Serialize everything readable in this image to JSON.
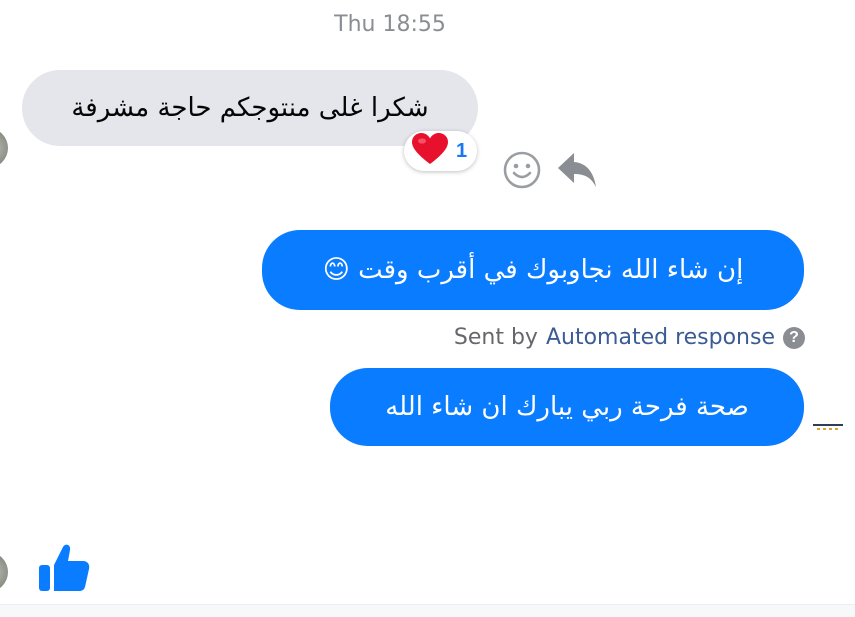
{
  "conversation": {
    "timestamp": "Thu 18:55",
    "messages": [
      {
        "direction": "incoming",
        "text": "شكرا غلى منتوجكم حاجة مشرفة",
        "reaction": {
          "emoji": "heart-icon",
          "count": "1"
        }
      },
      {
        "direction": "outgoing",
        "text": "إن شاء الله نجاوبوك في أقرب وقت 😊"
      },
      {
        "direction": "outgoing",
        "text": "صحة فرحة ربي يبارك  ان شاء الله"
      }
    ],
    "sent_by": {
      "prefix": "Sent by",
      "name": "Automated response"
    }
  },
  "colors": {
    "outgoing_bubble": "#0a7cff",
    "incoming_bubble": "#e4e6eb",
    "like": "#0a7cff",
    "reaction_count": "#1877f2"
  },
  "icons": {
    "react": "smiley-icon",
    "reply": "reply-arrow-icon",
    "help": "question-mark-icon",
    "like": "thumbs-up-icon"
  },
  "help_glyph": "?"
}
